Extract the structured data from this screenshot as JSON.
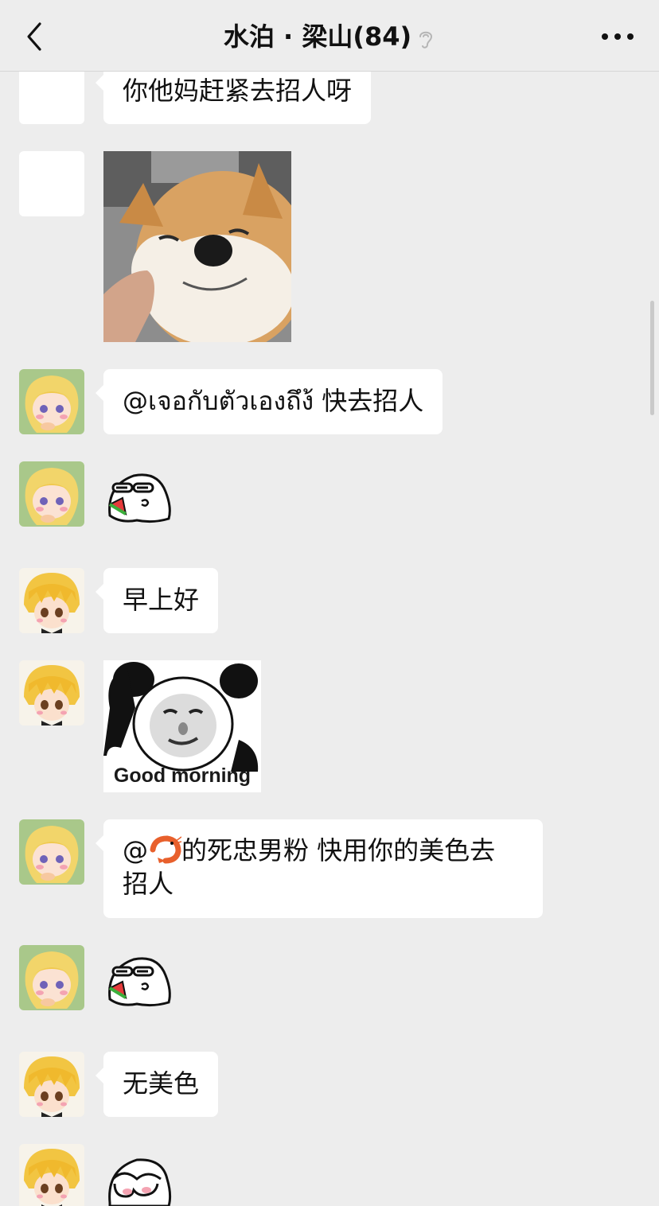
{
  "header": {
    "title": "水泊 · 梁山(84)",
    "back_icon": "chevron-left-icon",
    "mute_icon": "ear-off-icon",
    "more_icon": "more-dots-icon"
  },
  "messages": [
    {
      "type": "text",
      "avatar": "blank",
      "text": "你他妈赶紧去招人呀"
    },
    {
      "type": "image",
      "avatar": "blank",
      "image": "shiba-dog-photo"
    },
    {
      "type": "text",
      "avatar": "blonde-girl-avatar",
      "text": "@เจอกับตัวเองถึง้ 快去招人"
    },
    {
      "type": "sticker",
      "avatar": "blonde-girl-avatar",
      "sticker": "ghost-eating-watermelon-sticker"
    },
    {
      "type": "text",
      "avatar": "blonde-boy-avatar",
      "text": "早上好"
    },
    {
      "type": "image",
      "avatar": "blonde-boy-avatar",
      "image": "panda-meme",
      "caption": "Good morning"
    },
    {
      "type": "text",
      "avatar": "blonde-girl-avatar",
      "mention_prefix": "@",
      "emoji": "shrimp-emoji",
      "line1": "的死忠男粉 快用你的美色去",
      "line2": "招人"
    },
    {
      "type": "sticker",
      "avatar": "blonde-girl-avatar",
      "sticker": "ghost-eating-watermelon-sticker"
    },
    {
      "type": "text",
      "avatar": "blonde-boy-avatar",
      "text": "无美色"
    },
    {
      "type": "sticker",
      "avatar": "blonde-boy-avatar",
      "sticker": "ghost-covering-face-sticker"
    }
  ],
  "colors": {
    "background": "#ededed",
    "bubble": "#ffffff",
    "text": "#111111"
  }
}
